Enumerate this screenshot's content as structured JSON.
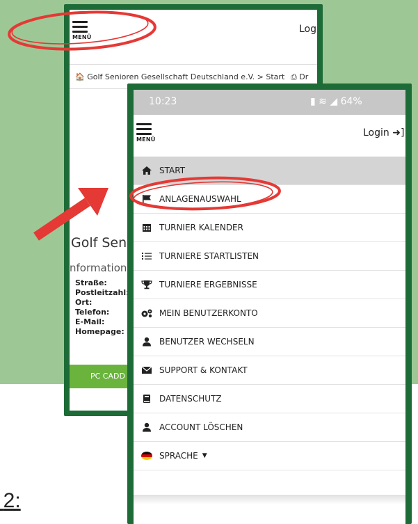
{
  "step_label": "2:",
  "back_screen": {
    "menu_label": "MENÜ",
    "login": "Log",
    "breadcrumb": "Golf Senioren Gesellschaft Deutschland e.V. > Start",
    "print": "Dr",
    "heading": "Golf Seni",
    "info": "nformation",
    "fields": [
      "Straße:",
      "Postleitzahl:",
      "Ort:",
      "Telefon:",
      "E-Mail:",
      "Homepage:"
    ],
    "button": "PC CADD"
  },
  "front_screen": {
    "status_time": "10:23",
    "status_right": "64%",
    "menu_label": "MENÜ",
    "login": "Login",
    "menu_items": [
      {
        "label": "START",
        "icon": "home-icon",
        "active": true
      },
      {
        "label": "ANLAGENAUSWAHL",
        "icon": "flag-icon",
        "active": false
      },
      {
        "label": "TURNIER KALENDER",
        "icon": "calendar-icon",
        "active": false
      },
      {
        "label": "TURNIERE STARTLISTEN",
        "icon": "list-icon",
        "active": false
      },
      {
        "label": "TURNIERE ERGEBNISSE",
        "icon": "trophy-icon",
        "active": false
      },
      {
        "label": "MEIN BENUTZERKONTO",
        "icon": "gears-icon",
        "active": false
      },
      {
        "label": "BENUTZER WECHSELN",
        "icon": "user-icon",
        "active": false
      },
      {
        "label": "SUPPORT & KONTAKT",
        "icon": "envelope-icon",
        "active": false
      },
      {
        "label": "DATENSCHUTZ",
        "icon": "book-icon",
        "active": false
      },
      {
        "label": "ACCOUNT LÖSCHEN",
        "icon": "user-icon",
        "active": false
      },
      {
        "label": "SPRACHE",
        "icon": "german-flag-icon",
        "active": false
      }
    ]
  },
  "colors": {
    "frame_green": "#1d6b37",
    "background_green": "#9dc896",
    "annotation_red": "#e53935",
    "button_green": "#6ab43e"
  }
}
